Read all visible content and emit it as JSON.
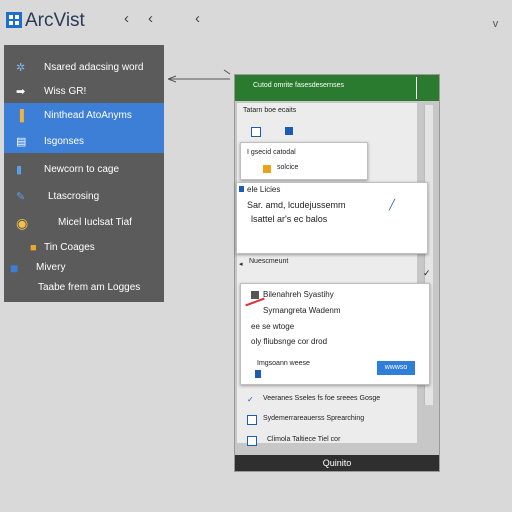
{
  "titlebar": {
    "app_title": "ArcVist",
    "back_icons": [
      "‹",
      "‹",
      "‹"
    ],
    "corner_icon": "ᵥ"
  },
  "sidebar": {
    "items": [
      {
        "label": "Nsared adacsing word",
        "icon": "puzzle-icon",
        "glyph": "✲"
      },
      {
        "label": "Wiss GR!",
        "icon": "arrow-icon",
        "glyph": "➡"
      },
      {
        "label": "Ninthead AtoAnyms",
        "icon": "book-icon",
        "glyph": "▐",
        "selected": true
      },
      {
        "label": "Isgonses",
        "icon": "list-icon",
        "glyph": "▤",
        "selected": true
      },
      {
        "label": "Newcorn to cage",
        "icon": "bookmark-icon",
        "glyph": "▮"
      },
      {
        "label": "Ltascrosing",
        "icon": "pen-icon",
        "glyph": "✎"
      },
      {
        "label": "Micel Iuclsat Tiaf",
        "icon": "globe-icon",
        "glyph": "◉"
      },
      {
        "label": "Tin Coages",
        "icon": "folder-icon",
        "glyph": "■"
      },
      {
        "label": "Mivery",
        "icon": "square-icon",
        "glyph": "■"
      },
      {
        "label": "Taabe frem am Logges",
        "icon": "",
        "glyph": ""
      }
    ]
  },
  "panel": {
    "header_title": "Cutod omrite fasesdesernses",
    "section_label": "Tatarn boe ecaits",
    "card1": {
      "line1": "I gsecid catodal",
      "line2": "solcice"
    },
    "card2": {
      "line1": "ele Licies",
      "line2": "Sar. amd, lcudejussemm",
      "line3": "lsattel ar's ec balos"
    },
    "mid_label": "Nuescmeunt",
    "card3": {
      "line1": "Bilenahreh Syastihy",
      "line2": "Syrnangreta Wadenm",
      "line3": "ee se wtoge",
      "line4": "oly fliubsnge cor drod",
      "line5": "Imgsoann weese",
      "button": "wwwso"
    },
    "list": [
      "Veeranes Sseles fs foe sreees Gosge",
      "Sydemerrareauerss Sprearching",
      "Climola Taltiece Tiel cor"
    ],
    "footer": "Quinito"
  },
  "colors": {
    "accent_green": "#2a7a2f",
    "accent_blue": "#3d7fd6",
    "sidebar_bg": "#5b5b5b"
  }
}
